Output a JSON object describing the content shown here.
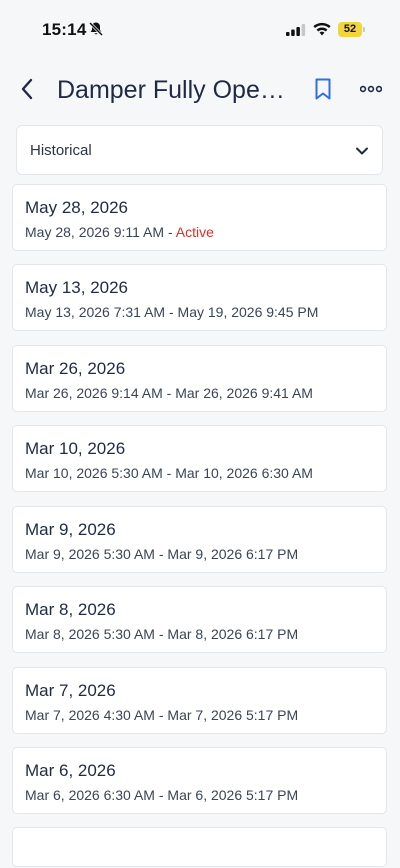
{
  "status_bar": {
    "time": "15:14",
    "battery": "52"
  },
  "header": {
    "title": "Damper Fully Open..."
  },
  "filter": {
    "selected": "Historical"
  },
  "events": [
    {
      "date": "May 28, 2026",
      "range": "May 28, 2026 9:11 AM",
      "separator": " - ",
      "status": "Active"
    },
    {
      "date": "May 13, 2026",
      "range": "May 13, 2026 7:31 AM - May 19, 2026 9:45 PM"
    },
    {
      "date": "Mar 26, 2026",
      "range": "Mar 26, 2026 9:14 AM - Mar 26, 2026 9:41 AM"
    },
    {
      "date": "Mar 10, 2026",
      "range": "Mar 10, 2026 5:30 AM - Mar 10, 2026 6:30 AM"
    },
    {
      "date": "Mar 9, 2026",
      "range": "Mar 9, 2026 5:30 AM - Mar 9, 2026 6:17 PM"
    },
    {
      "date": "Mar 8, 2026",
      "range": "Mar 8, 2026 5:30 AM - Mar 8, 2026 6:17 PM"
    },
    {
      "date": "Mar 7, 2026",
      "range": "Mar 7, 2026 4:30 AM - Mar 7, 2026 5:17 PM"
    },
    {
      "date": "Mar 6, 2026",
      "range": "Mar 6, 2026 6:30 AM - Mar 6, 2026 5:17 PM"
    }
  ],
  "colors": {
    "accent": "#2f6fe0",
    "active_status": "#d6312b",
    "battery": "#f2d53c"
  }
}
